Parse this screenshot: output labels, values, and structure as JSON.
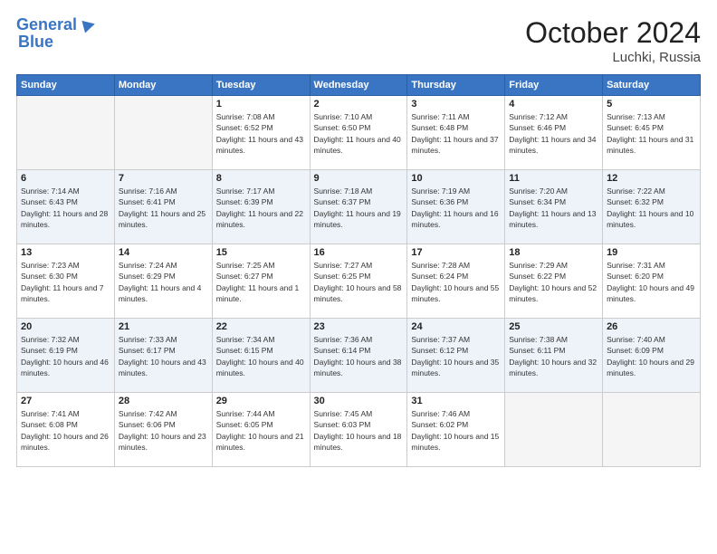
{
  "header": {
    "logo_line1": "General",
    "logo_line2": "Blue",
    "month": "October 2024",
    "location": "Luchki, Russia"
  },
  "weekdays": [
    "Sunday",
    "Monday",
    "Tuesday",
    "Wednesday",
    "Thursday",
    "Friday",
    "Saturday"
  ],
  "rows": [
    {
      "stripe": "odd",
      "cells": [
        {
          "day": "",
          "empty": true
        },
        {
          "day": "",
          "empty": true
        },
        {
          "day": "1",
          "info": "Sunrise: 7:08 AM\nSunset: 6:52 PM\nDaylight: 11 hours and 43 minutes."
        },
        {
          "day": "2",
          "info": "Sunrise: 7:10 AM\nSunset: 6:50 PM\nDaylight: 11 hours and 40 minutes."
        },
        {
          "day": "3",
          "info": "Sunrise: 7:11 AM\nSunset: 6:48 PM\nDaylight: 11 hours and 37 minutes."
        },
        {
          "day": "4",
          "info": "Sunrise: 7:12 AM\nSunset: 6:46 PM\nDaylight: 11 hours and 34 minutes."
        },
        {
          "day": "5",
          "info": "Sunrise: 7:13 AM\nSunset: 6:45 PM\nDaylight: 11 hours and 31 minutes."
        }
      ]
    },
    {
      "stripe": "even",
      "cells": [
        {
          "day": "6",
          "info": "Sunrise: 7:14 AM\nSunset: 6:43 PM\nDaylight: 11 hours and 28 minutes."
        },
        {
          "day": "7",
          "info": "Sunrise: 7:16 AM\nSunset: 6:41 PM\nDaylight: 11 hours and 25 minutes."
        },
        {
          "day": "8",
          "info": "Sunrise: 7:17 AM\nSunset: 6:39 PM\nDaylight: 11 hours and 22 minutes."
        },
        {
          "day": "9",
          "info": "Sunrise: 7:18 AM\nSunset: 6:37 PM\nDaylight: 11 hours and 19 minutes."
        },
        {
          "day": "10",
          "info": "Sunrise: 7:19 AM\nSunset: 6:36 PM\nDaylight: 11 hours and 16 minutes."
        },
        {
          "day": "11",
          "info": "Sunrise: 7:20 AM\nSunset: 6:34 PM\nDaylight: 11 hours and 13 minutes."
        },
        {
          "day": "12",
          "info": "Sunrise: 7:22 AM\nSunset: 6:32 PM\nDaylight: 11 hours and 10 minutes."
        }
      ]
    },
    {
      "stripe": "odd",
      "cells": [
        {
          "day": "13",
          "info": "Sunrise: 7:23 AM\nSunset: 6:30 PM\nDaylight: 11 hours and 7 minutes."
        },
        {
          "day": "14",
          "info": "Sunrise: 7:24 AM\nSunset: 6:29 PM\nDaylight: 11 hours and 4 minutes."
        },
        {
          "day": "15",
          "info": "Sunrise: 7:25 AM\nSunset: 6:27 PM\nDaylight: 11 hours and 1 minute."
        },
        {
          "day": "16",
          "info": "Sunrise: 7:27 AM\nSunset: 6:25 PM\nDaylight: 10 hours and 58 minutes."
        },
        {
          "day": "17",
          "info": "Sunrise: 7:28 AM\nSunset: 6:24 PM\nDaylight: 10 hours and 55 minutes."
        },
        {
          "day": "18",
          "info": "Sunrise: 7:29 AM\nSunset: 6:22 PM\nDaylight: 10 hours and 52 minutes."
        },
        {
          "day": "19",
          "info": "Sunrise: 7:31 AM\nSunset: 6:20 PM\nDaylight: 10 hours and 49 minutes."
        }
      ]
    },
    {
      "stripe": "even",
      "cells": [
        {
          "day": "20",
          "info": "Sunrise: 7:32 AM\nSunset: 6:19 PM\nDaylight: 10 hours and 46 minutes."
        },
        {
          "day": "21",
          "info": "Sunrise: 7:33 AM\nSunset: 6:17 PM\nDaylight: 10 hours and 43 minutes."
        },
        {
          "day": "22",
          "info": "Sunrise: 7:34 AM\nSunset: 6:15 PM\nDaylight: 10 hours and 40 minutes."
        },
        {
          "day": "23",
          "info": "Sunrise: 7:36 AM\nSunset: 6:14 PM\nDaylight: 10 hours and 38 minutes."
        },
        {
          "day": "24",
          "info": "Sunrise: 7:37 AM\nSunset: 6:12 PM\nDaylight: 10 hours and 35 minutes."
        },
        {
          "day": "25",
          "info": "Sunrise: 7:38 AM\nSunset: 6:11 PM\nDaylight: 10 hours and 32 minutes."
        },
        {
          "day": "26",
          "info": "Sunrise: 7:40 AM\nSunset: 6:09 PM\nDaylight: 10 hours and 29 minutes."
        }
      ]
    },
    {
      "stripe": "odd",
      "cells": [
        {
          "day": "27",
          "info": "Sunrise: 7:41 AM\nSunset: 6:08 PM\nDaylight: 10 hours and 26 minutes."
        },
        {
          "day": "28",
          "info": "Sunrise: 7:42 AM\nSunset: 6:06 PM\nDaylight: 10 hours and 23 minutes."
        },
        {
          "day": "29",
          "info": "Sunrise: 7:44 AM\nSunset: 6:05 PM\nDaylight: 10 hours and 21 minutes."
        },
        {
          "day": "30",
          "info": "Sunrise: 7:45 AM\nSunset: 6:03 PM\nDaylight: 10 hours and 18 minutes."
        },
        {
          "day": "31",
          "info": "Sunrise: 7:46 AM\nSunset: 6:02 PM\nDaylight: 10 hours and 15 minutes."
        },
        {
          "day": "",
          "empty": true
        },
        {
          "day": "",
          "empty": true
        }
      ]
    }
  ]
}
